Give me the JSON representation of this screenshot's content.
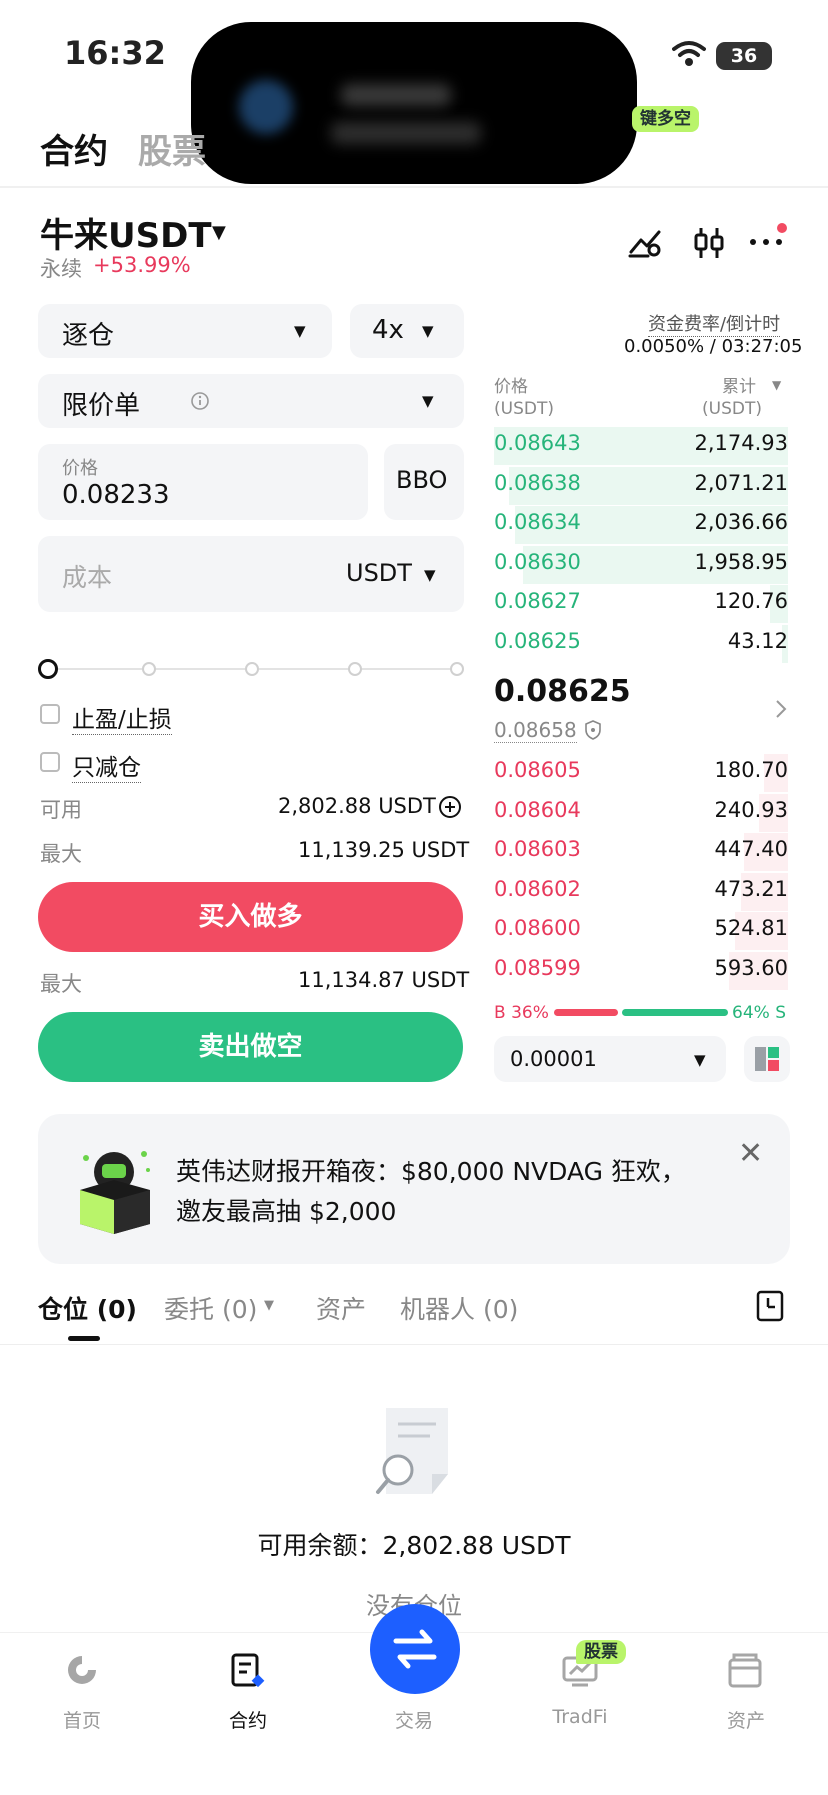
{
  "status": {
    "time": "16:32",
    "battery": "36"
  },
  "top_tabs": {
    "contract": "合约",
    "stocks": "股票",
    "badge": "键多空"
  },
  "symbol": {
    "name": "牛来USDT",
    "type": "永续",
    "change": "+53.99%"
  },
  "form": {
    "margin_mode": "逐仓",
    "leverage": "4x",
    "order_type": "限价单",
    "price_label": "价格",
    "price_value": "0.08233",
    "bbo_label": "BBO",
    "cost_placeholder": "成本",
    "cost_unit": "USDT",
    "tp_sl_label": "止盈/止损",
    "reduce_only_label": "只减仓",
    "available_label": "可用",
    "available_value": "2,802.88 USDT",
    "max_label": "最大",
    "max_buy_value": "11,139.25 USDT",
    "buy_label": "买入做多",
    "max_sell_value": "11,134.87 USDT",
    "sell_label": "卖出做空"
  },
  "orderbook": {
    "funding_label": "资金费率/倒计时",
    "funding_value": "0.0050% / 03:27:05",
    "price_header": "价格",
    "price_unit": "(USDT)",
    "total_header": "累计",
    "total_unit": "(USDT)",
    "top_rows": [
      {
        "price": "0.08643",
        "total": "2,174.93",
        "depth": 1.0
      },
      {
        "price": "0.08638",
        "total": "2,071.21",
        "depth": 0.95
      },
      {
        "price": "0.08634",
        "total": "2,036.66",
        "depth": 0.93
      },
      {
        "price": "0.08630",
        "total": "1,958.95",
        "depth": 0.9
      },
      {
        "price": "0.08627",
        "total": "120.76",
        "depth": 0.06
      },
      {
        "price": "0.08625",
        "total": "43.12",
        "depth": 0.02
      }
    ],
    "last_price": "0.08625",
    "mark_price": "0.08658",
    "bottom_rows": [
      {
        "price": "0.08605",
        "total": "180.70",
        "depth": 0.08
      },
      {
        "price": "0.08604",
        "total": "240.93",
        "depth": 0.1
      },
      {
        "price": "0.08603",
        "total": "447.40",
        "depth": 0.15
      },
      {
        "price": "0.08602",
        "total": "473.21",
        "depth": 0.16
      },
      {
        "price": "0.08600",
        "total": "524.81",
        "depth": 0.18
      },
      {
        "price": "0.08599",
        "total": "593.60",
        "depth": 0.2
      }
    ],
    "buy_ratio": "B 36%",
    "sell_ratio": "64% S",
    "precision": "0.00001"
  },
  "banner": {
    "line1": "英伟达财报开箱夜：$80,000 NVDAG 狂欢，",
    "line2": "邀友最高抽 $2,000"
  },
  "position_tabs": {
    "positions": "仓位 (0)",
    "orders": "委托 (0)",
    "assets": "资产",
    "bots": "机器人 (0)"
  },
  "empty": {
    "balance": "可用余额：2,802.88 USDT",
    "no_positions": "没有仓位"
  },
  "nav": {
    "home": "首页",
    "contract": "合约",
    "trade": "交易",
    "tradfi": "TradFi",
    "tradfi_badge": "股票",
    "assets": "资产"
  },
  "colors": {
    "buy": "#f24b62",
    "sell": "#2ac083",
    "accent": "#1d5fff",
    "badge": "#b9f46a"
  }
}
